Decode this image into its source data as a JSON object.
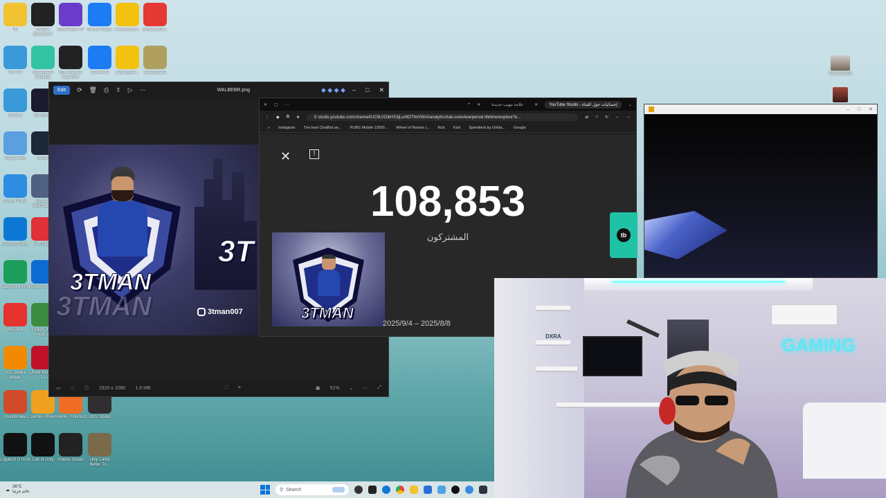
{
  "desktop_icons": [
    {
      "label": "PC",
      "icon": "folder-icon",
      "color": "#f1c232"
    },
    {
      "label": "NVIDIA Broadcast",
      "icon": "nvidia-icon",
      "color": "#222"
    },
    {
      "label": "XboxPlayer AT",
      "icon": "xbox-player-icon",
      "color": "#6a3cc9"
    },
    {
      "label": "Roblox Player",
      "icon": "roblox-icon",
      "color": "#1b7cf5"
    },
    {
      "label": "4442438829...",
      "icon": "emoji-cool-icon",
      "color": "#f3c20f"
    },
    {
      "label": "1626818619...",
      "icon": "arrow-red-icon",
      "color": "#e53935"
    },
    {
      "label": "This PC",
      "icon": "monitor-icon",
      "color": "#3a9ad9"
    },
    {
      "label": "Streamlabs Desktop",
      "icon": "streamlabs-icon",
      "color": "#31c3a2"
    },
    {
      "label": "Epic Games Launcher",
      "icon": "epic-games-icon",
      "color": "#222"
    },
    {
      "label": "LAN-lance",
      "icon": "network-icon",
      "color": "#1b7cf5"
    },
    {
      "label": "pray-clipart-...",
      "icon": "emoji-laugh-icon",
      "color": "#f3c20f"
    },
    {
      "label": "1222222222",
      "icon": "badge-icon",
      "color": "#b0a060"
    },
    {
      "label": "Network",
      "icon": "network-folder-icon",
      "color": "#3a9ad9"
    },
    {
      "label": "Speedtest",
      "icon": "speedtest-icon",
      "color": "#1b1b2e"
    },
    {
      "label": "Recycle Bin",
      "icon": "recycle-bin-icon",
      "color": "#5aa0e0"
    },
    {
      "label": "Steam",
      "icon": "steam-icon",
      "color": "#1b2838"
    },
    {
      "label": "Control Panel",
      "icon": "control-panel-icon",
      "color": "#2d8de0"
    },
    {
      "label": "System Information",
      "icon": "system-info-icon",
      "color": "#506080"
    },
    {
      "label": "Microsoft Edge",
      "icon": "edge-icon",
      "color": "#0d78d4"
    },
    {
      "label": "Riot Client",
      "icon": "riot-icon",
      "color": "#e0303a"
    },
    {
      "label": "Kaspersky VPN",
      "icon": "vpn-icon",
      "color": "#1d9e5c"
    },
    {
      "label": "Rocket League",
      "icon": "rocket-league-icon",
      "color": "#0d6ad3"
    },
    {
      "label": "AnyDesk",
      "icon": "anydesk-icon",
      "color": "#e5322d"
    },
    {
      "label": "Grand Theft Auto V",
      "icon": "gta-icon",
      "color": "#3d8b40"
    },
    {
      "label": "VLC media player",
      "icon": "vlc-icon",
      "color": "#f18a00"
    },
    {
      "label": "Driver Booster 12",
      "icon": "driver-booster-icon",
      "color": "#c0102a"
    },
    {
      "label": "HandBrake",
      "icon": "handbrake-icon",
      "color": "#d14b2a"
    },
    {
      "label": "Counter-Strike 2",
      "icon": "cs2-icon",
      "color": "#f0a020"
    },
    {
      "label": "FiveM - Shortcut",
      "icon": "fivem-icon",
      "color": "#f06d26"
    },
    {
      "label": "OBS Studio",
      "icon": "obs-icon",
      "color": "#302e31"
    },
    {
      "label": "Logitech G HUB",
      "icon": "logitech-icon",
      "color": "#111"
    },
    {
      "label": "Call of Duty",
      "icon": "cod-icon",
      "color": "#111"
    },
    {
      "label": "Roblox Studio",
      "icon": "roblox-studio-icon",
      "color": "#222"
    },
    {
      "label": "Only Climb Better To...",
      "icon": "game-icon",
      "color": "#7a6a4a"
    }
  ],
  "photos_window": {
    "edit_label": "Edit",
    "title": "WALBEBR.png",
    "status_dims": "1920 x 1080",
    "status_size": "1.8 MB",
    "zoom": "51%",
    "brand_name": "3TMAN",
    "handle": "3tman007"
  },
  "browser": {
    "tabs": [
      {
        "label": "علامة تبويب جديدة"
      },
      {
        "label": "إحصائيات حول القناة - YouTube Studio"
      }
    ],
    "url": "studio.youtube.com/channel/UC9LVOibHS3jLur9OTNrXWrA/analytics/tab-overview/period-lifetime/explore?e...",
    "bookmarks": [
      "Instagram",
      "The best ChatBot an...",
      "PUBG Mobile 12000...",
      "Wheel of Names |...",
      "Kick",
      "Kick",
      "Speedtest by Ookla...",
      "Google"
    ],
    "subscriber_count": "108,853",
    "subscriber_label": "المشتركون",
    "date_range": "2025/9/4 – 2025/8/8",
    "thumb_brand": "3TMAN"
  },
  "webcam": {
    "neon_text": "GAMING",
    "shelf_brand": "DXRA"
  },
  "top_right_icons": [
    {
      "label": "9204838383",
      "icon": "person-photo-icon"
    },
    {
      "label": "",
      "icon": "image-icon"
    }
  ],
  "taskbar": {
    "temperature": "26°C",
    "weather_desc": "غائم جزئيا",
    "search_placeholder": "Search"
  },
  "colors": {
    "accent_teal": "#20c2a6",
    "edit_blue": "#2f6ec5",
    "neon": "#5ee7f5"
  }
}
